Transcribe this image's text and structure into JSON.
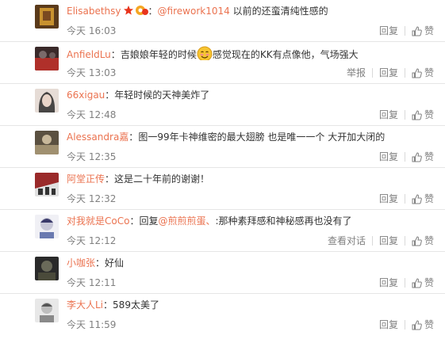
{
  "comments": [
    {
      "user": "Elisabethsy",
      "sep": "：",
      "mention": "@firework1014",
      "mention_sep": " ",
      "text": "以前的还蛮清纯性感的",
      "time": "今天 16:03",
      "extra": "",
      "reply": "回复",
      "like": "赞",
      "avatar_colors": [
        "#5a3a1a",
        "#c8922f"
      ]
    },
    {
      "user": "AnfieldLu",
      "sep": "：",
      "text_before": "吉娘娘年轻的时候",
      "text_after": "感觉现在的KK有点像他，气场强大",
      "time": "今天 13:03",
      "extra": "举报",
      "reply": "回复",
      "like": "赞",
      "avatar_colors": [
        "#3a2a2a",
        "#b0302a"
      ]
    },
    {
      "user": "66xigau",
      "sep": "：",
      "text": "年轻时候的天神美炸了",
      "time": "今天 12:48",
      "extra": "",
      "reply": "回复",
      "like": "赞",
      "avatar_colors": [
        "#2b2b2b",
        "#d8c4b8"
      ]
    },
    {
      "user": "Alessandra嘉",
      "sep": "：",
      "text": "图一99年卡神维密的最大翅膀 也是唯一一个 大开加大闭的",
      "time": "今天 12:35",
      "extra": "",
      "reply": "回复",
      "like": "赞",
      "avatar_colors": [
        "#5a5040",
        "#a09070"
      ]
    },
    {
      "user": "阿堂正传",
      "sep": "：",
      "text": "这是二十年前的谢谢！",
      "time": "今天 12:32",
      "extra": "",
      "reply": "回复",
      "like": "赞",
      "avatar_colors": [
        "#9a2a2a",
        "#e0e0e0"
      ]
    },
    {
      "user": "对我就是CoCo",
      "sep": "：",
      "reply_prefix": "回复",
      "mention": "@煎煎煎蛋、",
      "mention_sep": ":",
      "text": "那种素拜感和神秘感再也没有了",
      "time": "今天 12:12",
      "extra": "查看对话",
      "reply": "回复",
      "like": "赞",
      "avatar_colors": [
        "#c8c8d8",
        "#3a3a6a"
      ]
    },
    {
      "user": "小咖张",
      "sep": "：",
      "text": "好仙",
      "time": "今天 12:11",
      "extra": "",
      "reply": "回复",
      "like": "赞",
      "avatar_colors": [
        "#2a2a2a",
        "#6a6a5a"
      ]
    },
    {
      "user": "李大人Li",
      "sep": "：",
      "text": "589太美了",
      "time": "今天 11:59",
      "extra": "",
      "reply": "回复",
      "like": "赞",
      "avatar_colors": [
        "#e8e8e8",
        "#555555"
      ]
    }
  ]
}
